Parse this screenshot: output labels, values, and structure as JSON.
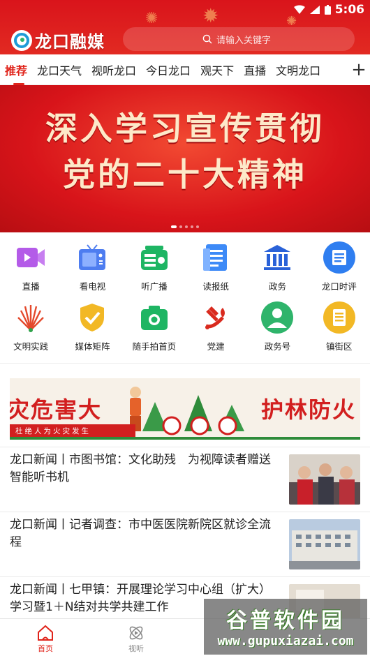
{
  "status_bar": {
    "time": "5:06"
  },
  "header": {
    "app_name": "龙口融媒",
    "search_placeholder": "请输入关键字"
  },
  "tabs": [
    {
      "label": "推荐",
      "active": true
    },
    {
      "label": "龙口天气"
    },
    {
      "label": "视听龙口"
    },
    {
      "label": "今日龙口"
    },
    {
      "label": "观天下"
    },
    {
      "label": "直播"
    },
    {
      "label": "文明龙口"
    }
  ],
  "tabs_add_symbol": "+",
  "banner": {
    "line1": "深入学习宣传贯彻",
    "line2": "党的二十大精神",
    "slide_count": 5,
    "active_slide": 1
  },
  "grid": {
    "row1": [
      {
        "label": "直播",
        "icon": "video-camera-icon",
        "color": "#b45be8"
      },
      {
        "label": "看电视",
        "icon": "tv-icon",
        "color": "#4e7df0"
      },
      {
        "label": "听广播",
        "icon": "radio-icon",
        "color": "#1eb563"
      },
      {
        "label": "读报纸",
        "icon": "newspaper-icon",
        "color": "#3d8af7"
      },
      {
        "label": "政务",
        "icon": "government-building-icon",
        "color": "#2a62d8"
      },
      {
        "label": "龙口时评",
        "icon": "commentary-icon",
        "color": "#2f7ef0"
      }
    ],
    "row2": [
      {
        "label": "文明实践",
        "icon": "flower-emblem-icon",
        "color": "#e4492c"
      },
      {
        "label": "媒体矩阵",
        "icon": "shield-check-icon",
        "color": "#f2b825"
      },
      {
        "label": "随手拍首页",
        "icon": "camera-icon",
        "color": "#1eb563"
      },
      {
        "label": "党建",
        "icon": "party-emblem-icon",
        "color": "#d92a1e"
      },
      {
        "label": "政务号",
        "icon": "official-account-icon",
        "color": "#2fb46b"
      },
      {
        "label": "镇街区",
        "icon": "district-icon",
        "color": "#f2b825"
      }
    ]
  },
  "ad": {
    "left_text": "灾危害大",
    "right_text": "护林防火",
    "strip_text": "杜绝人为火灾发生"
  },
  "news": [
    {
      "title": "龙口新闻丨市图书馆：文化助残　为视障读者赠送智能听书机"
    },
    {
      "title": "龙口新闻丨记者调查：市中医医院新院区就诊全流程"
    },
    {
      "title": "龙口新闻丨七甲镇：开展理论学习中心组（扩大）学习暨1＋N结对共学共建工作"
    }
  ],
  "bottom_nav": [
    {
      "label": "首页",
      "icon": "home-icon",
      "active": true
    },
    {
      "label": "视听",
      "icon": "play-orbit-icon"
    }
  ],
  "watermark": {
    "title": "谷普软件园",
    "url": "www.gupuxiazai.com"
  },
  "colors": {
    "brand_red": "#e0241b",
    "header_red": "#d9141b"
  }
}
